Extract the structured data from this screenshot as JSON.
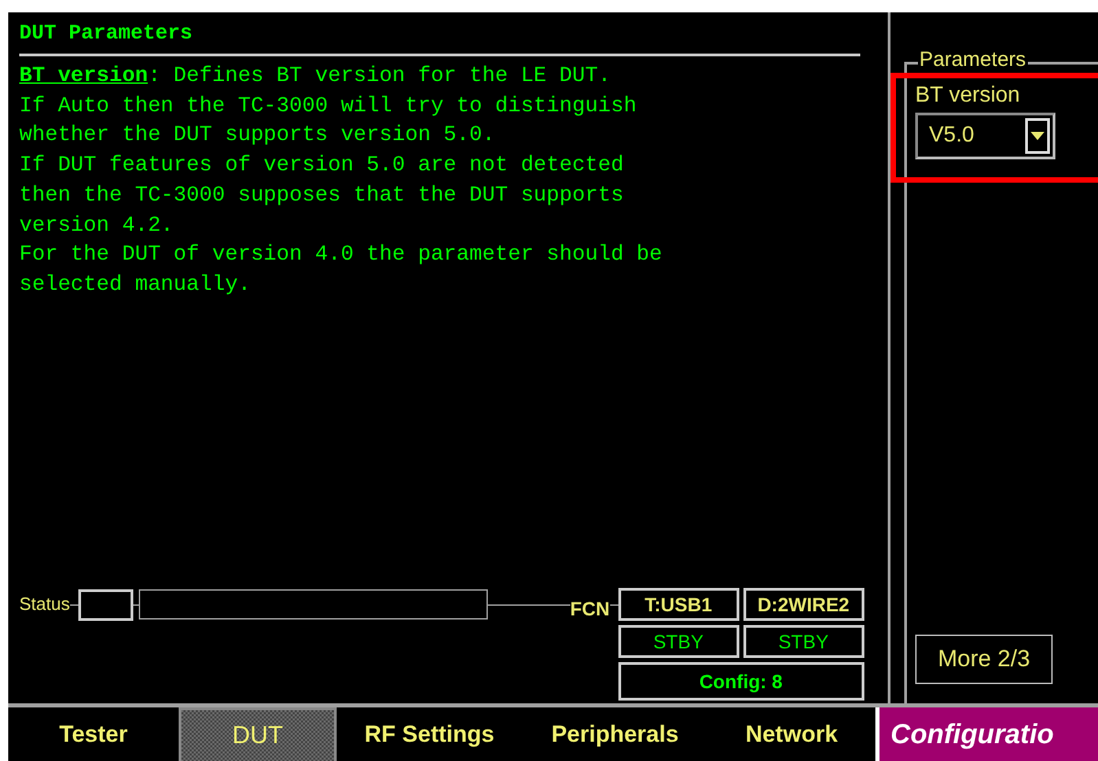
{
  "panel": {
    "title": "DUT Parameters",
    "help_lines": [
      "**BT version**: Defines BT version for the LE DUT.",
      "If Auto then the TC-3000 will try to distinguish",
      "whether the DUT supports version 5.0.",
      "If DUT features of version 5.0 are not detected",
      "then the TC-3000 supposes that the DUT supports",
      "version 4.2.",
      "For the DUT of version 4.0 the parameter should be",
      "selected manually."
    ]
  },
  "parameters": {
    "group_title": "Parameters",
    "field_label": "BT version",
    "value": "V5.0",
    "highlighted": true,
    "more_button": "More 2/3"
  },
  "status": {
    "label": "Status",
    "fcn_label": "FCN",
    "cells": [
      {
        "text": "T:USB1",
        "kind": "port"
      },
      {
        "text": "D:2WIRE2",
        "kind": "port"
      },
      {
        "text": "STBY",
        "kind": "state"
      },
      {
        "text": "STBY",
        "kind": "state"
      }
    ],
    "config": "Config: 8"
  },
  "tabs": [
    {
      "label": "Tester",
      "selected": false,
      "kind": "normal"
    },
    {
      "label": "DUT",
      "selected": true,
      "kind": "normal"
    },
    {
      "label": "RF Settings",
      "selected": false,
      "kind": "normal"
    },
    {
      "label": "Peripherals",
      "selected": false,
      "kind": "normal"
    },
    {
      "label": "Network",
      "selected": false,
      "kind": "normal"
    },
    {
      "label": "Configuratio",
      "selected": false,
      "kind": "menu"
    }
  ]
}
